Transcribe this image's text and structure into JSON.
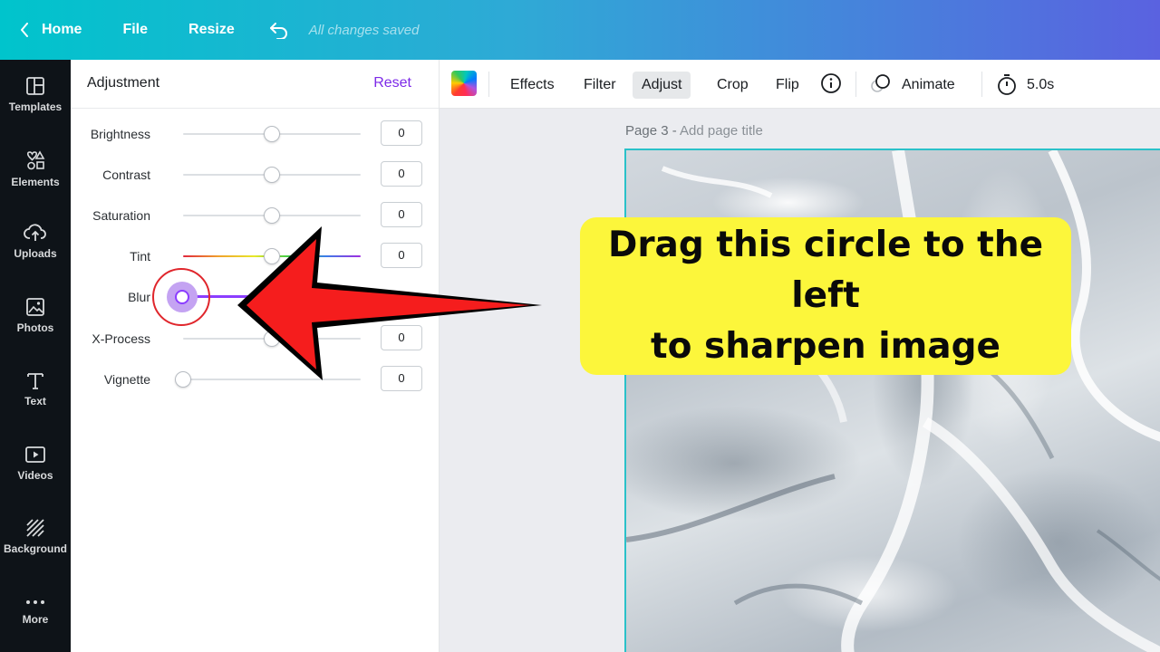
{
  "topbar": {
    "home_label": "Home",
    "file_label": "File",
    "resize_label": "Resize",
    "saved_status": "All changes saved"
  },
  "rail": {
    "items": [
      {
        "label": "Templates",
        "icon": "templates-icon"
      },
      {
        "label": "Elements",
        "icon": "elements-icon"
      },
      {
        "label": "Uploads",
        "icon": "uploads-icon"
      },
      {
        "label": "Photos",
        "icon": "photos-icon"
      },
      {
        "label": "Text",
        "icon": "text-icon"
      },
      {
        "label": "Videos",
        "icon": "videos-icon"
      },
      {
        "label": "Background",
        "icon": "background-icon"
      },
      {
        "label": "More",
        "icon": "more-icon"
      }
    ]
  },
  "panel": {
    "title": "Adjustment",
    "reset_label": "Reset",
    "sliders": [
      {
        "label": "Brightness",
        "value": "0",
        "fraction": 0.5
      },
      {
        "label": "Contrast",
        "value": "0",
        "fraction": 0.5
      },
      {
        "label": "Saturation",
        "value": "0",
        "fraction": 0.5
      },
      {
        "label": "Tint",
        "value": "0",
        "fraction": 0.5
      },
      {
        "label": "Blur",
        "value": "",
        "fraction": 0.0
      },
      {
        "label": "X-Process",
        "value": "0",
        "fraction": 0.5
      },
      {
        "label": "Vignette",
        "value": "0",
        "fraction": 0.0
      }
    ]
  },
  "toolbar": {
    "effects_label": "Effects",
    "filter_label": "Filter",
    "adjust_label": "Adjust",
    "crop_label": "Crop",
    "flip_label": "Flip",
    "animate_label": "Animate",
    "duration_label": "5.0s"
  },
  "canvas": {
    "page_label": "Page 3 - ",
    "page_title_placeholder": "Add page title"
  },
  "annotation": {
    "callout_line1": "Drag this circle to the left",
    "callout_line2": "to sharpen image",
    "arrow_color": "#f51d1d",
    "callout_color": "#fcf63b"
  },
  "colors": {
    "accent": "#7d2ae8",
    "selection": "#2ac1c9",
    "rail_bg": "#0e1318"
  }
}
